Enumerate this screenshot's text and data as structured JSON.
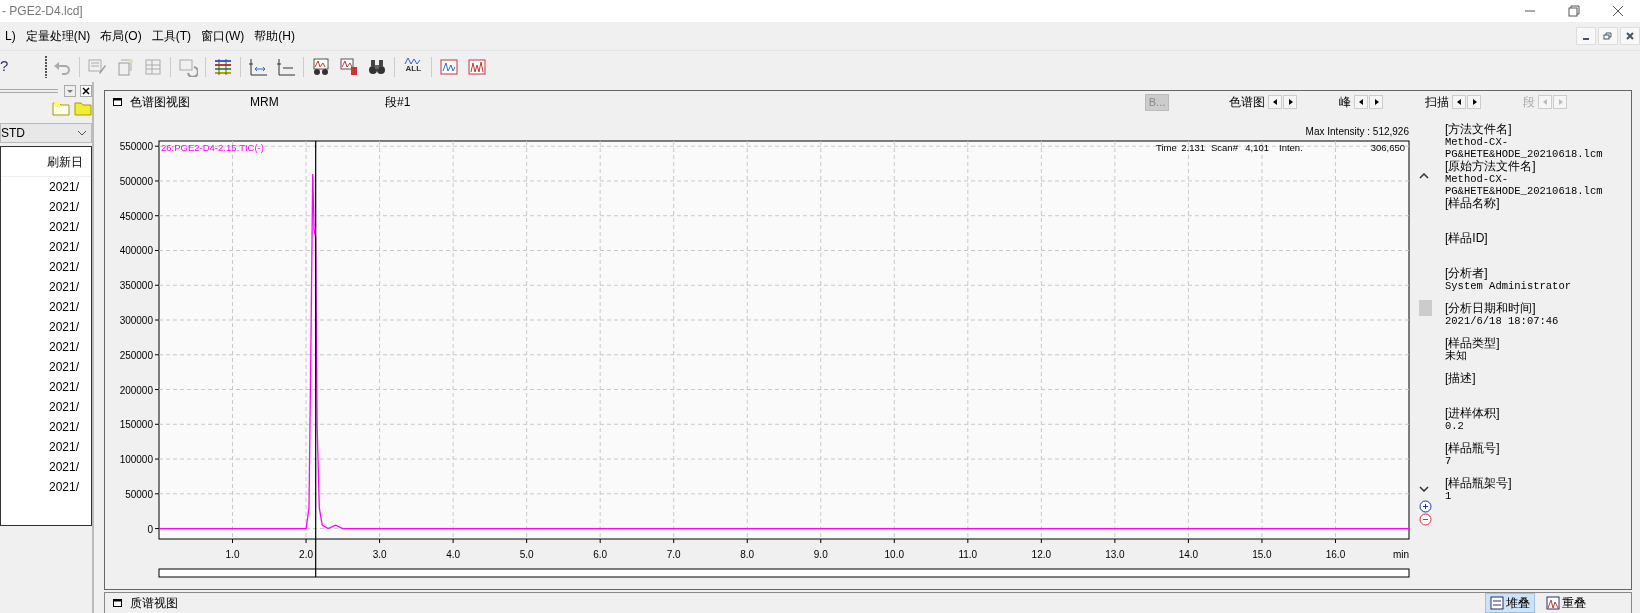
{
  "window": {
    "title": "- PGE2-D4.lcd]"
  },
  "menu": [
    "L)",
    "定量处理(N)",
    "布局(O)",
    "工具(T)",
    "窗口(W)",
    "帮助(H)"
  ],
  "toolbar": {
    "help": "?",
    "all_label": "ALL"
  },
  "left_panel": {
    "combo": "STD",
    "column": "刷新日",
    "rows": [
      "2021/",
      "2021/",
      "2021/",
      "2021/",
      "2021/",
      "2021/",
      "2021/",
      "2021/",
      "2021/",
      "2021/",
      "2021/",
      "2021/",
      "2021/",
      "2021/",
      "2021/",
      "2021/"
    ]
  },
  "chromatogram_view": {
    "title": "色谱图视图",
    "mode": "MRM",
    "segment": "段#1",
    "b_button": "B...",
    "navigators": [
      {
        "label": "色谱图",
        "disabled": false
      },
      {
        "label": "峰",
        "disabled": false
      },
      {
        "label": "扫描",
        "disabled": false
      },
      {
        "label": "段",
        "disabled": true
      }
    ],
    "max_intensity": "Max Intensity : 512,926",
    "readout": [
      {
        "label": "Time",
        "value": "2.131"
      },
      {
        "label": "Scan#",
        "value": "4,101"
      },
      {
        "label": "Inten.",
        "value": "306,650"
      }
    ],
    "chart_data": {
      "type": "line",
      "xlabel": "min",
      "x": [
        0,
        1.9,
        2.0,
        2.04,
        2.07,
        2.09,
        2.11,
        2.13,
        2.15,
        2.18,
        2.22,
        2.3,
        2.4,
        2.5,
        3.0,
        17.0
      ],
      "series": [
        {
          "name": "26:PGE2-D4-2.15.TIC(-)",
          "color": "#ff00ff",
          "values": [
            0,
            0,
            0,
            30000,
            300000,
            510000,
            430000,
            420000,
            150000,
            30000,
            5000,
            0,
            5000,
            0,
            0,
            0
          ]
        }
      ],
      "grid": true,
      "ref_lines": [
        {
          "axis": "x",
          "value": 2.131
        }
      ],
      "xlim": [
        0,
        17
      ],
      "ylim": [
        -15000,
        557500
      ],
      "xticks": [
        {
          "value": 1,
          "label": "1.0"
        },
        {
          "value": 2,
          "label": "2.0"
        },
        {
          "value": 3,
          "label": "3.0"
        },
        {
          "value": 4,
          "label": "4.0"
        },
        {
          "value": 5,
          "label": "5.0"
        },
        {
          "value": 6,
          "label": "6.0"
        },
        {
          "value": 7,
          "label": "7.0"
        },
        {
          "value": 8,
          "label": "8.0"
        },
        {
          "value": 9,
          "label": "9.0"
        },
        {
          "value": 10,
          "label": "10.0"
        },
        {
          "value": 11,
          "label": "11.0"
        },
        {
          "value": 12,
          "label": "12.0"
        },
        {
          "value": 13,
          "label": "13.0"
        },
        {
          "value": 14,
          "label": "14.0"
        },
        {
          "value": 15,
          "label": "15.0"
        },
        {
          "value": 16,
          "label": "16.0"
        }
      ],
      "yticks": [
        0,
        50000,
        100000,
        150000,
        200000,
        250000,
        300000,
        350000,
        400000,
        450000,
        500000,
        550000
      ]
    }
  },
  "info": [
    {
      "label": "[方法文件名]",
      "value": "Method-CX-PG&HETE&HODE_20210618.lcm"
    },
    {
      "label": "[原始方法文件名]",
      "value": "Method-CX-PG&HETE&HODE_20210618.lcm"
    },
    {
      "label": "[样品名称]"
    },
    {
      "label": "[样品ID]"
    },
    {
      "label": "[分析者]",
      "value": "System Administrator"
    },
    {
      "label": "[分析日期和时间]",
      "value": "2021/6/18 18:07:46"
    },
    {
      "label": "[样品类型]",
      "value": "未知"
    },
    {
      "label": "[描述]"
    },
    {
      "label": "[进样体积]",
      "value": "0.2"
    },
    {
      "label": "[样品瓶号]",
      "value": "7"
    },
    {
      "label": "[样品瓶架号]",
      "value": "1"
    }
  ],
  "spectrum_view": {
    "title": "质谱视图",
    "buttons": [
      {
        "label": "堆叠",
        "selected": true
      },
      {
        "label": "重叠",
        "selected": false
      }
    ]
  }
}
